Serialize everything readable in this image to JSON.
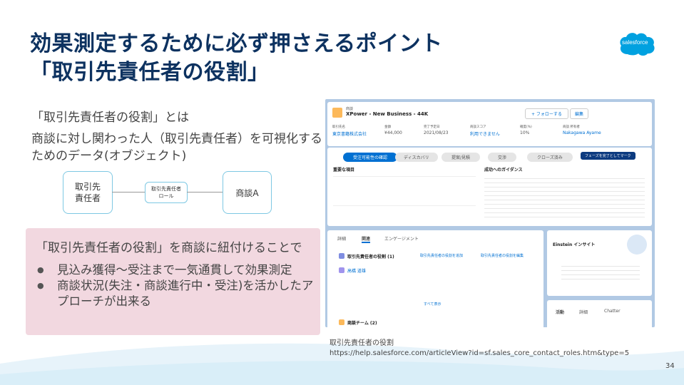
{
  "slide": {
    "title_line1": "効果測定するために必ず押さえるポイント",
    "title_line2": "「取引先責任者の役割」",
    "logo_text": "salesforce",
    "subtitle": "「取引先責任者の役割」とは",
    "description": "商談に対し関わった人（取引先責任者）を可視化するためのデータ(オブジェクト)",
    "diagram": {
      "node_left": "取引先\n責任者",
      "node_middle": "取引先責任者\nロール",
      "node_right": "商談A"
    },
    "callout": {
      "heading": "「取引先責任者の役割」を商談に紐付けることで",
      "bullets": [
        "見込み獲得〜受注まで一気通貫して効果測定",
        "商談状況(失注・商談進行中・受注)を活かしたアプローチが出来る"
      ]
    },
    "screenshot": {
      "record_type": "商談",
      "record_title": "XPower - New Business - 44K",
      "follow_button": "+ フォローする",
      "edit_button": "編集",
      "fields": [
        "取引先名",
        "金額",
        "完了予定日",
        "商談スコア",
        "確度(%)",
        "商談 所有者"
      ],
      "field_values": [
        "東京書籍株式会社",
        "¥44,000",
        "2021/08/23",
        "利用できません",
        "10%",
        "Nakagawa Ayame"
      ],
      "path_stages": [
        "受注可能性の確認",
        "ディスカバリ",
        "提案/見積",
        "交渉",
        "クローズ済み"
      ],
      "path_button": "フェーズを完了としてマーク",
      "key_fields": "重要な項目",
      "guidance": "成功へのガイダンス",
      "tabs": [
        "詳細",
        "関連",
        "エンゲージメント"
      ],
      "related_list": "取引先責任者の役割 (1)",
      "related_add": "取引先責任者の役割を追加",
      "related_edit": "取引先責任者の役割を編集",
      "contact_name": "高橋 道雄",
      "show_all": "すべて表示",
      "team": "商談チーム (2)",
      "einstein": "Einstein インサイト",
      "activity_tabs": [
        "活動",
        "詳細",
        "Chatter"
      ]
    },
    "caption": "取引先責任者の役割",
    "url": "https://help.salesforce.com/articleView?id=sf.sales_core_contact_roles.htm&type=5",
    "page_number": "34",
    "colors": {
      "title": "#0d3260",
      "accent": "#00a1e0",
      "callout_bg": "#f2d8e0"
    }
  }
}
